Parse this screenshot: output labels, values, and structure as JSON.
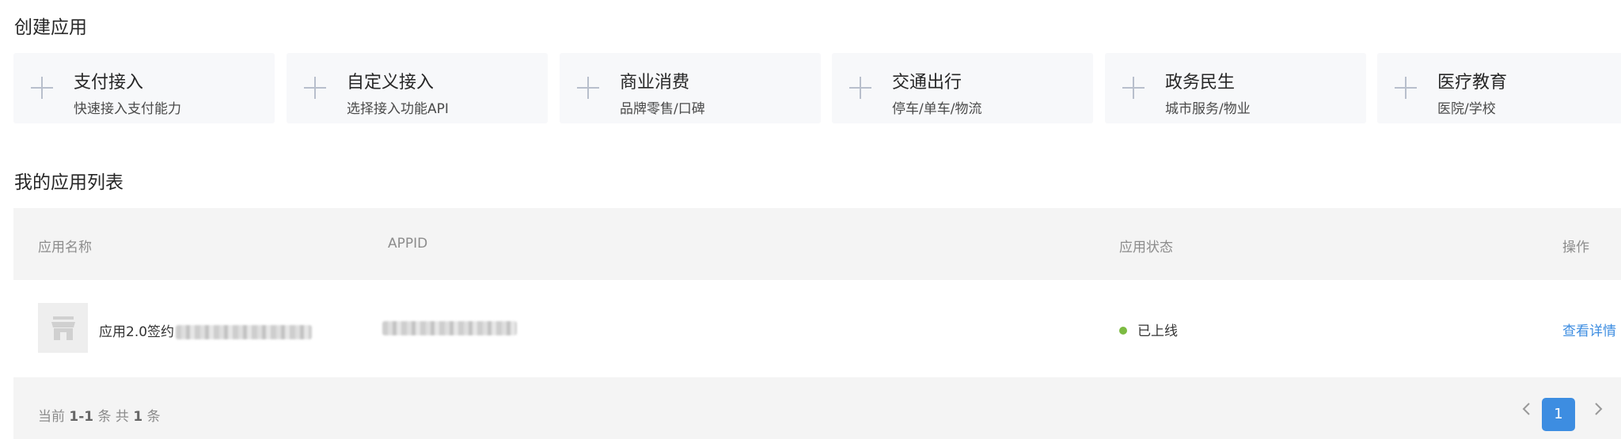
{
  "create_section": {
    "title": "创建应用",
    "cards": [
      {
        "title": "支付接入",
        "desc": "快速接入支付能力"
      },
      {
        "title": "自定义接入",
        "desc": "选择接入功能API"
      },
      {
        "title": "商业消费",
        "desc": "品牌零售/口碑"
      },
      {
        "title": "交通出行",
        "desc": "停车/单车/物流"
      },
      {
        "title": "政务民生",
        "desc": "城市服务/物业"
      },
      {
        "title": "医疗教育",
        "desc": "医院/学校"
      }
    ],
    "card_icon": "plus-icon"
  },
  "list_section": {
    "title": "我的应用列表",
    "columns": {
      "name": "应用名称",
      "appid": "APPID",
      "status": "应用状态",
      "action": "操作"
    },
    "rows": [
      {
        "name_prefix": "应用2.0签约",
        "thumb_icon": "store-icon",
        "status": "已上线",
        "status_color": "#7cbb42",
        "action": "查看详情"
      }
    ]
  },
  "pagination": {
    "summary_prefix": "当前",
    "range": "1-1",
    "summary_middle": "条 共",
    "total": "1",
    "summary_suffix": "条",
    "current_page": "1",
    "prev_icon": "chevron-left-icon",
    "next_icon": "chevron-right-icon"
  },
  "colors": {
    "accent": "#3d8de1",
    "card_bg": "#f7f8fa",
    "header_bg": "#f4f4f4",
    "online": "#7cbb42"
  }
}
